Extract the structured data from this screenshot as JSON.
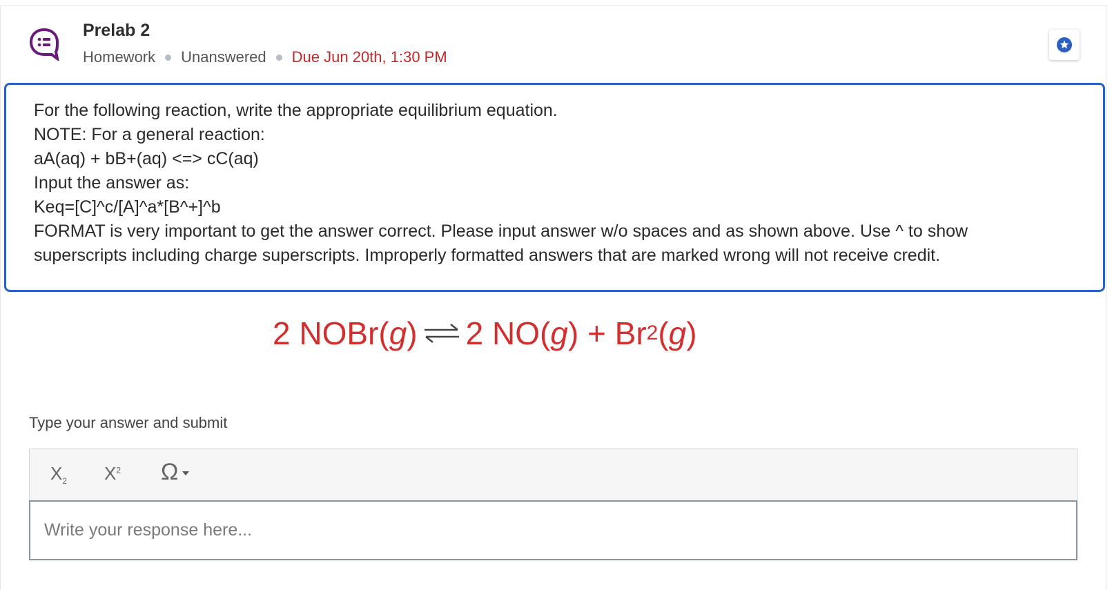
{
  "header": {
    "title": "Prelab 2",
    "type": "Homework",
    "status": "Unanswered",
    "due": "Due Jun 20th, 1:30 PM"
  },
  "question": {
    "lines": [
      "For the following reaction, write the appropriate equilibrium equation.",
      "NOTE: For a general reaction:",
      "aA(aq) + bB+(aq) <=> cC(aq)",
      "Input the answer as:",
      "Keq=[C]^c/[A]^a*[B^+]^b",
      "FORMAT is very important to get the answer correct. Please input answer w/o spaces and as shown above. Use ^ to show",
      "superscripts including charge superscripts. Improperly formatted answers that are marked wrong will not receive credit."
    ]
  },
  "equation": {
    "left": "2 NOBr(",
    "left_g": "g",
    "left_close": ")",
    "right_a": "2 NO(",
    "right_a_g": "g",
    "right_a_close": ") + Br",
    "right_sub": "2",
    "right_b": "(",
    "right_b_g": "g",
    "right_b_close": ")"
  },
  "answer": {
    "label": "Type your answer and submit",
    "placeholder": "Write your response here...",
    "toolbar": {
      "subscript": "X",
      "subscript_small": "2",
      "superscript": "X",
      "superscript_small": "2",
      "special_chars": "Ω"
    }
  },
  "colors": {
    "accent": "#2b5fc4",
    "due": "#c62828",
    "equation": "#d32f2f",
    "icon": "#6a1b7a"
  },
  "icons": {
    "question_type": "chat-bubble-list-icon",
    "favorite": "star-icon",
    "dropdown": "chevron-down-icon"
  }
}
